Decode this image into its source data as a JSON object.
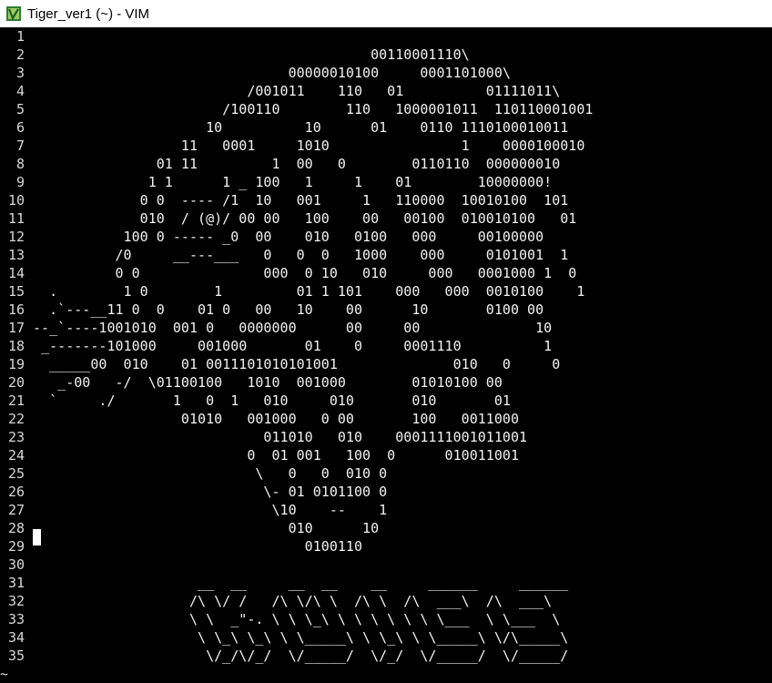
{
  "window": {
    "title": "Tiger_ver1 (~) - VIM"
  },
  "buffer": {
    "lines": [
      {
        "n": "1",
        "text": ""
      },
      {
        "n": "2",
        "text": "                                         00110001110\\"
      },
      {
        "n": "3",
        "text": "                               00000010100     0001101000\\"
      },
      {
        "n": "4",
        "text": "                          /001011    110   01          01111011\\"
      },
      {
        "n": "5",
        "text": "                       /100110        110   1000001011  110110001001"
      },
      {
        "n": "6",
        "text": "                     10          10      01    0110 1110100010011"
      },
      {
        "n": "7",
        "text": "                  11   0001     1010                1    0000100010"
      },
      {
        "n": "8",
        "text": "               01 11         1  00   0        0110110  000000010"
      },
      {
        "n": "9",
        "text": "              1 1      1 _ 100   1     1    01        10000000!"
      },
      {
        "n": "10",
        "text": "             0 0  ---- /1  10   001     1   110000  10010100  101"
      },
      {
        "n": "11",
        "text": "             010  / (@)/ 00 00   100    00   00100  010010100   01"
      },
      {
        "n": "12",
        "text": "           100 0 ----- _0  00    010   0100   000     00100000"
      },
      {
        "n": "13",
        "text": "          /0     __---___   0   0  0   1000    000     0101001  1"
      },
      {
        "n": "14",
        "text": "          0 0               000  0 10   010     000   0001000 1  0"
      },
      {
        "n": "15",
        "text": "  .        1 0        1         01 1 101    000   000  0010100    1"
      },
      {
        "n": "16",
        "text": "  .`---__11 0  0    01 0   00   10    00      10       0100 00"
      },
      {
        "n": "17",
        "text": "--_`----1001010  001 0   0000000      00     00              10"
      },
      {
        "n": "18",
        "text": " _-------101000     001000       01    0     0001110          1"
      },
      {
        "n": "19",
        "text": "  _____00  010    01 0011101010101001              010   0     0"
      },
      {
        "n": "20",
        "text": "   _-00   -/  \\01100100   1010  001000        01010100 00"
      },
      {
        "n": "21",
        "text": "  `     ./       1   0  1   010     010       010       01"
      },
      {
        "n": "22",
        "text": "                  01010   001000   0 00       100   0011000"
      },
      {
        "n": "23",
        "text": "                            011010   010    0001111001011001"
      },
      {
        "n": "24",
        "text": "                          0  01 001   100  0      010011001"
      },
      {
        "n": "25",
        "text": "                           \\   0   0  010 0"
      },
      {
        "n": "26",
        "text": "                            \\- 01 0101100 0"
      },
      {
        "n": "27",
        "text": "                             \\10    --    1"
      },
      {
        "n": "28",
        "text": "                               010      10"
      },
      {
        "n": "29",
        "text": "                                 0100110"
      },
      {
        "n": "30",
        "text": ""
      },
      {
        "n": "31",
        "text": "                    __  __     __  __    __     ______     ______"
      },
      {
        "n": "32",
        "text": "                   /\\ \\/ /   /\\ \\/\\ \\  /\\ \\  /\\  ___\\  /\\  ___\\"
      },
      {
        "n": "33",
        "text": "                   \\ \\  _\"-. \\ \\ \\_\\ \\ \\ \\ \\ \\ \\ \\___  \\ \\___  \\"
      },
      {
        "n": "34",
        "text": "                    \\ \\_\\ \\_\\ \\ \\_____\\ \\ \\_\\ \\ \\_____\\ \\/\\_____\\"
      },
      {
        "n": "35",
        "text": "                     \\/_/\\/_/  \\/_____/  \\/_/  \\/_____/  \\/_____/"
      }
    ],
    "tilde": "~"
  },
  "colors": {
    "background": "#000000",
    "foreground": "#f2f2f2",
    "titlebar": "#ffffff"
  }
}
